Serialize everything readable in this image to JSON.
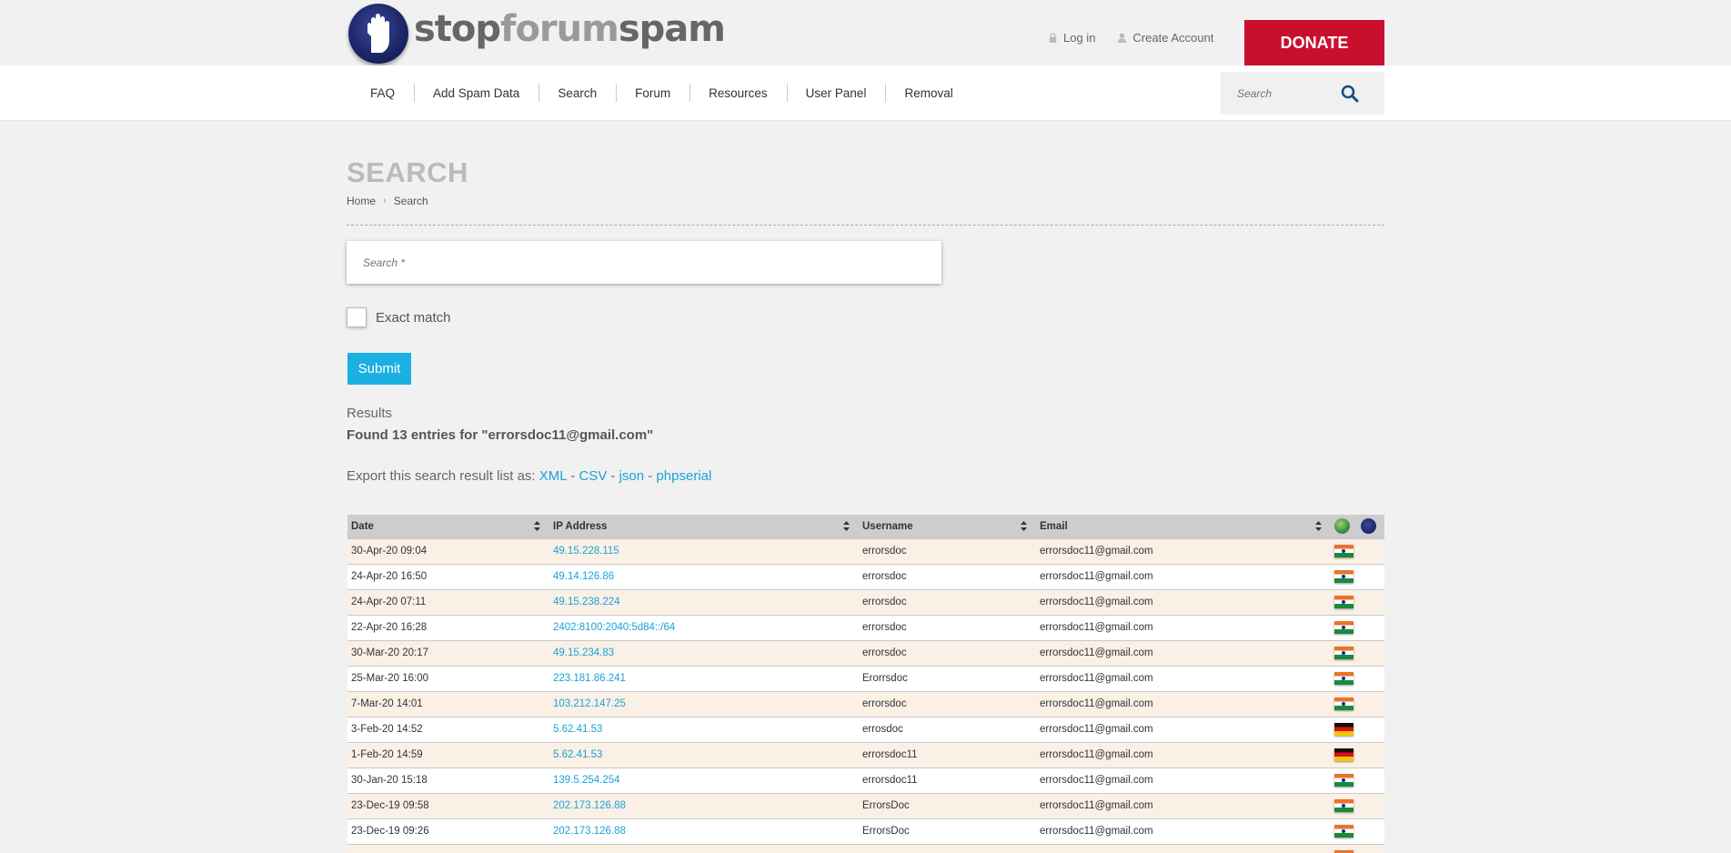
{
  "header": {
    "logo": {
      "part1": "stop",
      "part2": "forum",
      "part3": "spam"
    },
    "login_label": "Log in",
    "create_account_label": "Create Account",
    "donate_label": "DONATE"
  },
  "nav": {
    "items": [
      "FAQ",
      "Add Spam Data",
      "Search",
      "Forum",
      "Resources",
      "User Panel",
      "Removal"
    ],
    "search_placeholder": "Search"
  },
  "page": {
    "title": "SEARCH",
    "breadcrumb": [
      "Home",
      "Search"
    ]
  },
  "search_form": {
    "placeholder": "Search *",
    "exact_match_label": "Exact match",
    "submit_label": "Submit"
  },
  "results": {
    "label": "Results",
    "found_text": "Found 13 entries for \"errorsdoc11@gmail.com\"",
    "export_prefix": "Export this search result list as: ",
    "export_links": [
      "XML",
      "CSV",
      "json",
      "phpserial"
    ],
    "export_sep": " - "
  },
  "table": {
    "columns": [
      "Date",
      "IP Address",
      "Username",
      "Email"
    ],
    "rows": [
      {
        "date": "30-Apr-20 09:04",
        "ip": "49.15.228.115",
        "username": "errorsdoc",
        "email": "errorsdoc11@gmail.com",
        "flag": "IN"
      },
      {
        "date": "24-Apr-20 16:50",
        "ip": "49.14.126.86",
        "username": "errorsdoc",
        "email": "errorsdoc11@gmail.com",
        "flag": "IN"
      },
      {
        "date": "24-Apr-20 07:11",
        "ip": "49.15.238.224",
        "username": "errorsdoc",
        "email": "errorsdoc11@gmail.com",
        "flag": "IN"
      },
      {
        "date": "22-Apr-20 16:28",
        "ip": "2402:8100:2040:5d84::/64",
        "username": "errorsdoc",
        "email": "errorsdoc11@gmail.com",
        "flag": "IN"
      },
      {
        "date": "30-Mar-20 20:17",
        "ip": "49.15.234.83",
        "username": "errorsdoc",
        "email": "errorsdoc11@gmail.com",
        "flag": "IN"
      },
      {
        "date": "25-Mar-20 16:00",
        "ip": "223.181.86.241",
        "username": "Erorrsdoc",
        "email": "errorsdoc11@gmail.com",
        "flag": "IN"
      },
      {
        "date": "7-Mar-20 14:01",
        "ip": "103.212.147.25",
        "username": "errorsdoc",
        "email": "errorsdoc11@gmail.com",
        "flag": "IN"
      },
      {
        "date": "3-Feb-20 14:52",
        "ip": "5.62.41.53",
        "username": "errosdoc",
        "email": "errorsdoc11@gmail.com",
        "flag": "DE"
      },
      {
        "date": "1-Feb-20 14:59",
        "ip": "5.62.41.53",
        "username": "errorsdoc11",
        "email": "errorsdoc11@gmail.com",
        "flag": "DE"
      },
      {
        "date": "30-Jan-20 15:18",
        "ip": "139.5.254.254",
        "username": "errorsdoc11",
        "email": "errorsdoc11@gmail.com",
        "flag": "IN"
      },
      {
        "date": "23-Dec-19 09:58",
        "ip": "202.173.126.88",
        "username": "ErrorsDoc",
        "email": "errorsdoc11@gmail.com",
        "flag": "IN"
      },
      {
        "date": "23-Dec-19 09:26",
        "ip": "202.173.126.88",
        "username": "ErrorsDoc",
        "email": "errorsdoc11@gmail.com",
        "flag": "IN"
      },
      {
        "date": "",
        "ip": "",
        "username": "",
        "email": "",
        "flag": "IN"
      }
    ]
  },
  "colors": {
    "donate": "#c8102e",
    "link": "#1aa3d8",
    "submit": "#1ab0e3"
  }
}
